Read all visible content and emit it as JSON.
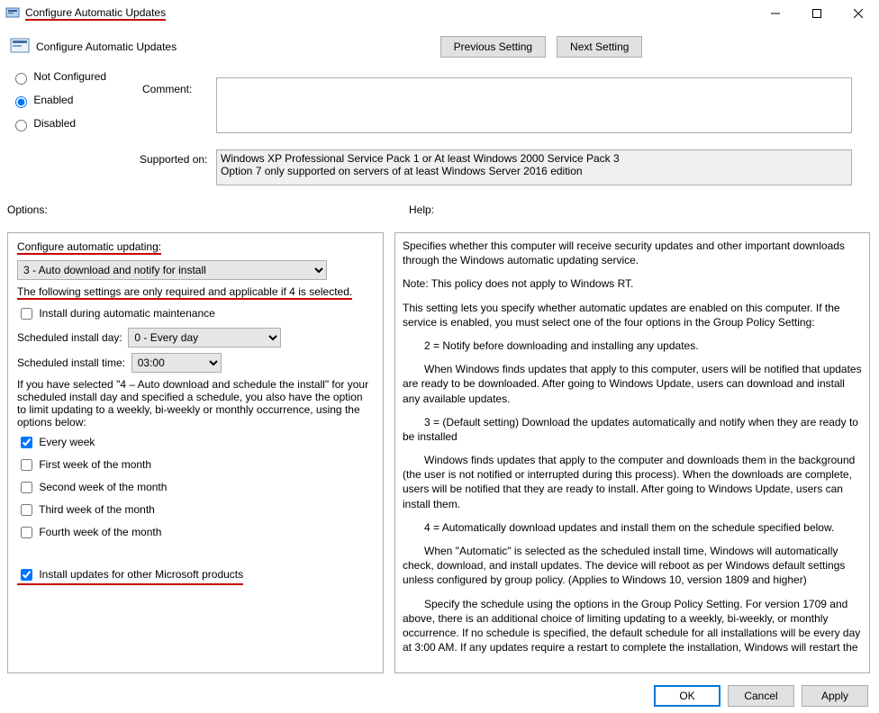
{
  "window": {
    "title": "Configure Automatic Updates"
  },
  "header": {
    "policy_title": "Configure Automatic Updates",
    "prev_btn": "Previous Setting",
    "next_btn": "Next Setting"
  },
  "state_radios": {
    "not_configured": "Not Configured",
    "enabled": "Enabled",
    "disabled": "Disabled",
    "selected": "enabled"
  },
  "comment": {
    "label": "Comment:",
    "value": ""
  },
  "supported": {
    "label": "Supported on:",
    "line1": "Windows XP Professional Service Pack 1 or At least Windows 2000 Service Pack 3",
    "line2": "Option 7 only supported on servers of at least Windows Server 2016 edition"
  },
  "section_labels": {
    "options": "Options:",
    "help": "Help:"
  },
  "options": {
    "configure_label": "Configure automatic updating:",
    "configure_value": "3 - Auto download and notify for install",
    "note4": "The following settings are only required and applicable if 4 is selected.",
    "cb_maintenance": "Install during automatic maintenance",
    "cb_maintenance_checked": false,
    "day_label": "Scheduled install day:",
    "day_value": "0 - Every day",
    "time_label": "Scheduled install time:",
    "time_value": "03:00",
    "note_schedule": "If you have selected \"4 – Auto download and schedule the install\" for your scheduled install day and specified a schedule, you also have the option to limit updating to a weekly, bi-weekly or monthly occurrence, using the options below:",
    "cb_every_week": "Every week",
    "cb_every_week_checked": true,
    "cb_w1": "First week of the month",
    "cb_w1_checked": false,
    "cb_w2": "Second week of the month",
    "cb_w2_checked": false,
    "cb_w3": "Third week of the month",
    "cb_w3_checked": false,
    "cb_w4": "Fourth week of the month",
    "cb_w4_checked": false,
    "cb_other_ms": "Install updates for other Microsoft products",
    "cb_other_ms_checked": true
  },
  "help": {
    "p1": "Specifies whether this computer will receive security updates and other important downloads through the Windows automatic updating service.",
    "p2": "Note: This policy does not apply to Windows RT.",
    "p3": "This setting lets you specify whether automatic updates are enabled on this computer. If the service is enabled, you must select one of the four options in the Group Policy Setting:",
    "p4": "2 = Notify before downloading and installing any updates.",
    "p5": "When Windows finds updates that apply to this computer, users will be notified that updates are ready to be downloaded. After going to Windows Update, users can download and install any available updates.",
    "p6": "3 = (Default setting) Download the updates automatically and notify when they are ready to be installed",
    "p7": "Windows finds updates that apply to the computer and downloads them in the background (the user is not notified or interrupted during this process). When the downloads are complete, users will be notified that they are ready to install. After going to Windows Update, users can install them.",
    "p8": "4 = Automatically download updates and install them on the schedule specified below.",
    "p9": "When \"Automatic\" is selected as the scheduled install time, Windows will automatically check, download, and install updates. The device will reboot as per Windows default settings unless configured by group policy. (Applies to Windows 10, version 1809 and higher)",
    "p10": "Specify the schedule using the options in the Group Policy Setting. For version 1709 and above, there is an additional choice of limiting updating to a weekly, bi-weekly, or monthly occurrence. If no schedule is specified, the default schedule for all installations will be every day at 3:00 AM. If any updates require a restart to complete the installation, Windows will restart the"
  },
  "buttons": {
    "ok": "OK",
    "cancel": "Cancel",
    "apply": "Apply"
  }
}
